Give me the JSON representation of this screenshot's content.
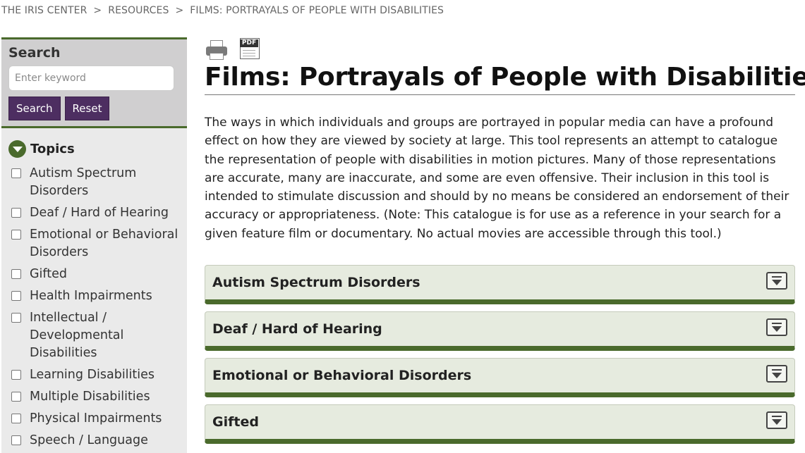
{
  "breadcrumb": {
    "items": [
      "THE IRIS CENTER",
      "RESOURCES",
      "FILMS: PORTRAYALS OF PEOPLE WITH DISABILITIES"
    ],
    "separator": ">"
  },
  "sidebar": {
    "search": {
      "title": "Search",
      "placeholder": "Enter keyword",
      "search_label": "Search",
      "reset_label": "Reset"
    },
    "topics": {
      "title": "Topics",
      "items": [
        {
          "label": "Autism Spectrum Disorders"
        },
        {
          "label": "Deaf / Hard of Hearing"
        },
        {
          "label": "Emotional or Behavioral Disorders"
        },
        {
          "label": "Gifted"
        },
        {
          "label": "Health Impairments"
        },
        {
          "label": "Intellectual / Developmental Disabilities"
        },
        {
          "label": "Learning Disabilities"
        },
        {
          "label": "Multiple Disabilities"
        },
        {
          "label": "Physical Impairments"
        },
        {
          "label": "Speech / Language"
        }
      ]
    }
  },
  "main": {
    "title": "Films: Portrayals of People with Disabilities",
    "tools": {
      "pdf_label": "PDF"
    },
    "intro": "The ways in which individuals and groups are portrayed in popular media can have a profound effect on how they are viewed by society at large. This tool represents an attempt to catalogue the representation of people with disabilities in motion pictures. Many of those representations are accurate, many are inaccurate, and some are even offensive. Their inclusion in this tool is intended to stimulate discussion and should by no means be considered an endorsement of their accuracy or appropriateness. (Note: This catalogue is for use as a reference in your search for a given feature film or documentary. No actual movies are accessible through this tool.)",
    "accordion": [
      {
        "label": "Autism Spectrum Disorders"
      },
      {
        "label": "Deaf / Hard of Hearing"
      },
      {
        "label": "Emotional or Behavioral Disorders"
      },
      {
        "label": "Gifted"
      }
    ]
  },
  "colors": {
    "accent_green": "#4a6a2c",
    "button_purple": "#4d2e61",
    "accordion_bg": "#e6ebdf"
  }
}
